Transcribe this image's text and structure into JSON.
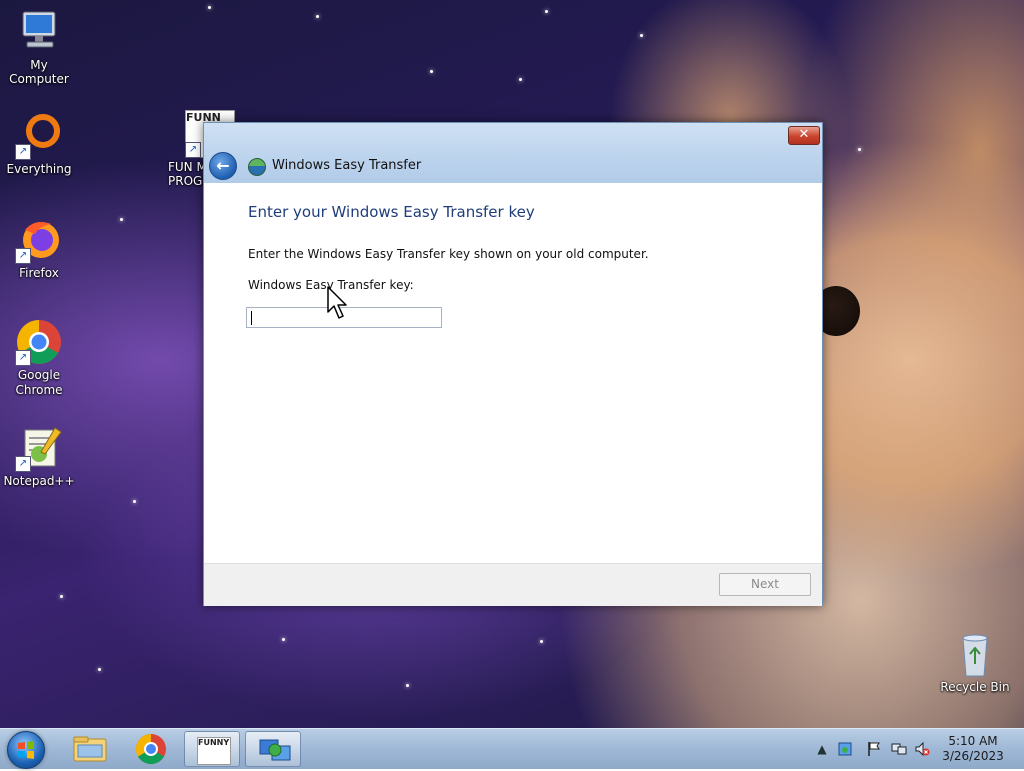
{
  "desktop": {
    "icons": [
      {
        "label": "My Computer",
        "icon": "computer-icon"
      },
      {
        "label": "Everything",
        "icon": "everything-search-icon"
      },
      {
        "label": "FUN MO",
        "label2": "PROGR",
        "icon": "funny-program-icon",
        "icon_text": "FUNN"
      },
      {
        "label": "Firefox",
        "icon": "firefox-icon"
      },
      {
        "label": "Google",
        "label2": "Chrome",
        "icon": "chrome-icon"
      },
      {
        "label": "Notepad++",
        "icon": "notepadpp-icon"
      },
      {
        "label": "Recycle Bin",
        "icon": "recycle-bin-icon"
      }
    ]
  },
  "window": {
    "title": "Windows Easy Transfer",
    "close_label": "✕",
    "back_label": "←",
    "heading": "Enter your Windows Easy Transfer key",
    "instructions": "Enter the Windows Easy Transfer key shown on your old computer.",
    "key_label": "Windows Easy Transfer key:",
    "key_value": "",
    "next_label": "Next",
    "next_enabled": false
  },
  "taskbar": {
    "pinned": [
      {
        "name": "windows-explorer",
        "icon": "folder-icon"
      },
      {
        "name": "google-chrome",
        "icon": "chrome-icon"
      },
      {
        "name": "funny-program",
        "icon": "funny-program-icon",
        "icon_text": "FUNNY!"
      },
      {
        "name": "windows-easy-transfer",
        "icon": "easy-transfer-icon",
        "active": true
      }
    ],
    "tray": {
      "show_hidden_icon": "▲",
      "clock_time": "5:10 AM",
      "clock_date": "3/26/2023"
    }
  },
  "colors": {
    "accent": "#1f3d7a",
    "titlebar": "#c4d8ef",
    "close_button": "#c9442c"
  }
}
